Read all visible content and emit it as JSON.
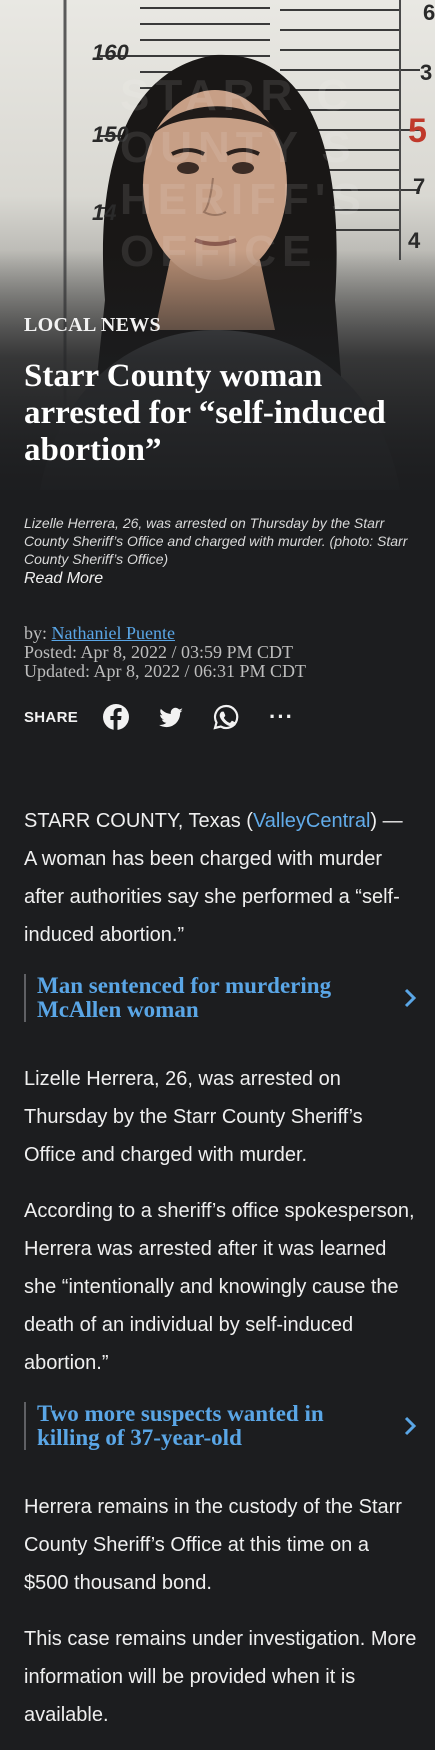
{
  "hero": {
    "height_marks": [
      "160",
      "150",
      "14"
    ],
    "side_marks": [
      "6",
      "3",
      "5",
      "7",
      "4"
    ],
    "watermark": "STARR COUNTY SHERIFF'S OFFICE"
  },
  "section_label": "LOCAL NEWS",
  "headline": "Starr County woman arrested for “self-induced abortion”",
  "caption": "Lizelle Herrera, 26, was arrested on Thursday by the Starr County Sheriff’s Office and charged with murder. (photo: Starr County Sheriff’s Office)",
  "read_more": "Read More",
  "byline": {
    "by_prefix": "by: ",
    "author": "Nathaniel Puente",
    "posted": "Posted: Apr 8, 2022 / 03:59 PM CDT",
    "updated": "Updated: Apr 8, 2022 / 06:31 PM CDT"
  },
  "share": {
    "label": "SHARE",
    "icons": [
      "facebook-icon",
      "twitter-icon",
      "whatsapp-icon",
      "more-icon"
    ],
    "more": "···"
  },
  "article": {
    "p1_prefix": "STARR COUNTY, Texas (",
    "p1_link": "ValleyCentral",
    "p1_suffix": ") — A woman has been charged with murder after authorities say she performed a “self-induced abortion.”",
    "related1": "Man sentenced for murdering McAllen woman",
    "p2": "Lizelle Herrera, 26, was arrested on Thursday by the Starr County Sheriff’s Office and charged with murder.",
    "p3": "According to a sheriff’s office spokesperson, Herrera was arrested after it was learned she “intentionally and knowingly cause the death of an individual by self-induced abortion.”",
    "related2": "Two more suspects wanted in killing of 37-year-old",
    "p4": "Herrera remains in the custody of the Starr County Sheriff’s Office at this time on a $500 thousand bond.",
    "p5": "This case remains under investigation. More information will be provided when it is available."
  },
  "colors": {
    "background": "#1c1d1f",
    "link": "#5aa6e6",
    "text": "#efefef"
  }
}
